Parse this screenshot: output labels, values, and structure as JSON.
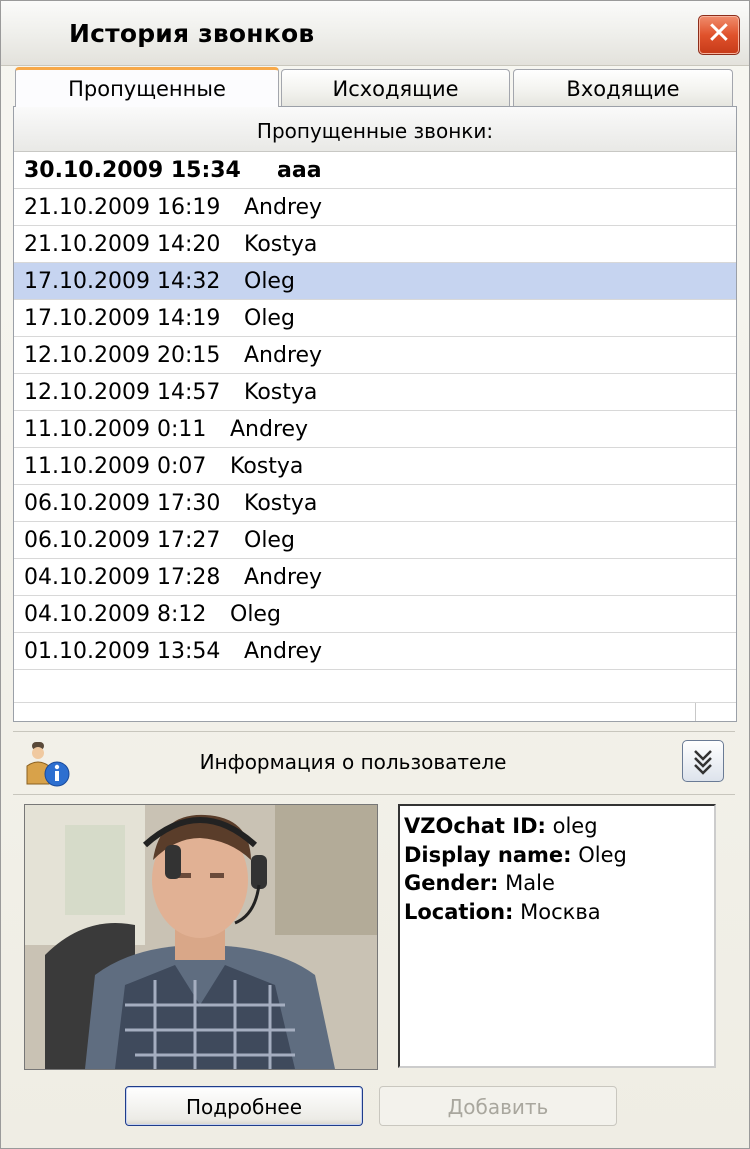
{
  "window": {
    "title": "История звонков",
    "close_glyph": "✕"
  },
  "tabs": [
    {
      "label": "Пропущенные",
      "active": true
    },
    {
      "label": "Исходящие",
      "active": false
    },
    {
      "label": "Входящие",
      "active": false
    }
  ],
  "list": {
    "header": "Пропущенные звонки:",
    "rows": [
      {
        "date": "30.10.2009 15:34",
        "name": "aaa",
        "bold": true
      },
      {
        "date": "21.10.2009 16:19",
        "name": "Andrey"
      },
      {
        "date": "21.10.2009 14:20",
        "name": "Kostya"
      },
      {
        "date": "17.10.2009 14:32",
        "name": "Oleg",
        "selected": true
      },
      {
        "date": "17.10.2009 14:19",
        "name": "Oleg"
      },
      {
        "date": "12.10.2009 20:15",
        "name": "Andrey"
      },
      {
        "date": "12.10.2009 14:57",
        "name": "Kostya"
      },
      {
        "date": "11.10.2009 0:11",
        "name": "Andrey"
      },
      {
        "date": "11.10.2009 0:07",
        "name": "Kostya"
      },
      {
        "date": "06.10.2009 17:30",
        "name": "Kostya"
      },
      {
        "date": "06.10.2009 17:27",
        "name": "Oleg"
      },
      {
        "date": "04.10.2009 17:28",
        "name": "Andrey"
      },
      {
        "date": "04.10.2009 8:12",
        "name": "Oleg"
      },
      {
        "date": "01.10.2009 13:54",
        "name": "Andrey"
      }
    ]
  },
  "user_info": {
    "title": "Информация о пользователе",
    "icon": "user-info-icon",
    "expand_icon": "double-chevron-down-icon",
    "id_label": "VZOchat ID:",
    "id_value": "oleg",
    "display_label": "Display name:",
    "display_value": "Oleg",
    "gender_label": "Gender:",
    "gender_value": "Male",
    "location_label": "Location:",
    "location_value": "Москва"
  },
  "buttons": {
    "details": "Подробнее",
    "add": "Добавить"
  },
  "colors": {
    "selected_row": "#c6d4f0",
    "active_tab_accent": "#f7a94a",
    "close_button": "#e0522c"
  }
}
